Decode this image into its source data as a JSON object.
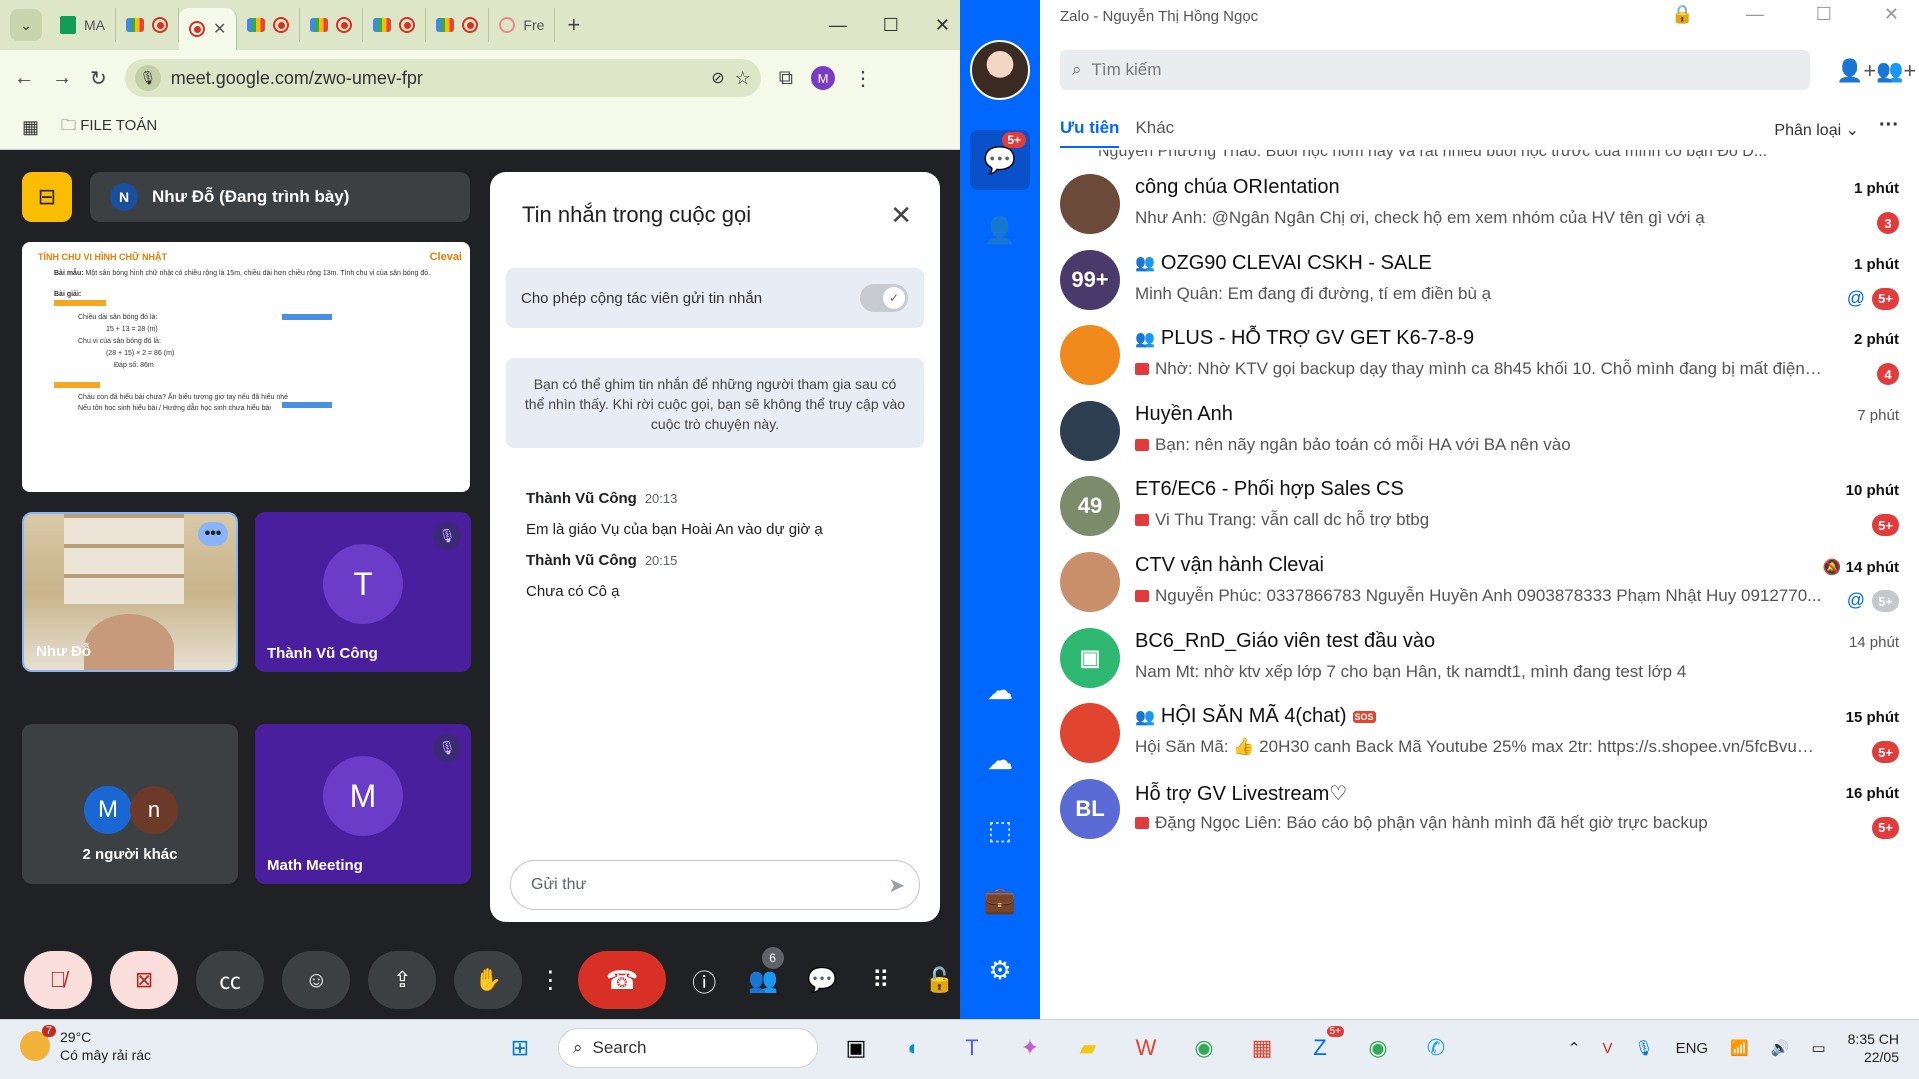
{
  "browser": {
    "tabs": [
      {
        "label": "MA",
        "icon": "sheets-icon"
      },
      {
        "label": "",
        "icon": "meet-icon"
      },
      {
        "label": "",
        "icon": "meet-icon"
      },
      {
        "label": "",
        "icon": "meet-icon"
      },
      {
        "label": "",
        "icon": "meet-icon"
      },
      {
        "label": "",
        "icon": "meet-icon"
      },
      {
        "label": "",
        "icon": "meet-icon"
      },
      {
        "label": "Fre",
        "icon": "page-icon"
      }
    ],
    "url": "meet.google.com/zwo-umev-fpr",
    "profile_initial": "M",
    "bookmark_folder": "FILE TOÁN"
  },
  "meet": {
    "presenter_initial": "N",
    "presenter_label": "Như Đỗ (Đang trình bày)",
    "slide": {
      "title": "TÍNH CHU VI HÌNH CHỮ NHẬT",
      "brand": "Clevai",
      "problem_label": "Bài mẫu:",
      "problem_text": "Một sân bóng hình chữ nhật có chiều rộng là 15m, chiều dài hơn chiều rộng 13m. Tính chu vi của sân bóng đó.",
      "solution_label": "Bài giải:",
      "line1": "Chiều dài sân bóng đó là:",
      "line2": "15 + 13 = 28 (m)",
      "line3": "Chu vi của sân bóng đó là:",
      "line4": "(28 + 15) × 2 = 86 (m)",
      "line5": "Đáp số: 86m",
      "hint1": "Cháu con đã hiểu bài chưa? Ấn biểu tượng giơ tay nếu đã hiểu nhé",
      "hint2": "Nếu tôn hoc sinh hiểu bài / Hướng dẫn học sinh chưa hiểu bài"
    },
    "tiles": {
      "self_name": "Như Đỗ",
      "t1_initial": "T",
      "t1_name": "Thành Vũ Công",
      "others_a": "M",
      "others_b": "n",
      "others_label": "2 người khác",
      "t2_initial": "M",
      "t2_name": "Math Meeting"
    },
    "chat": {
      "title": "Tin nhắn trong cuộc gọi",
      "allow_label": "Cho phép cộng tác viên gửi tin nhắn",
      "pin_note": "Bạn có thể ghim tin nhắn để những người tham gia sau có thể nhìn thấy. Khi rời cuộc gọi, bạn sẽ không thể truy cập vào cuộc trò chuyện này.",
      "messages": [
        {
          "sender": "Thành Vũ Công",
          "time": "20:13",
          "text": "Em là giáo Vụ của bạn Hoài An vào dự giờ ạ"
        },
        {
          "sender": "Thành Vũ Công",
          "time": "20:15",
          "text": "Chưa có Cô ạ"
        }
      ],
      "input_placeholder": "Gửi thư"
    },
    "participants_count": "6"
  },
  "zalo": {
    "window_title": "Zalo - Nguyễn Thị Hồng Ngọc",
    "search_placeholder": "Tìm kiếm",
    "tab_priority": "Ưu tiên",
    "tab_other": "Khác",
    "filter_label": "Phân loại",
    "messages_badge": "5+",
    "cut_preview": "Nguyễn Phương Thảo: Buổi học hôm nay và rất nhiều buổi học trước của mình có bạn Đỗ D...",
    "conversations": [
      {
        "name": "công chúa ORIentation",
        "preview": "Như Anh: @Ngân Ngân Chị ơi, check hộ em xem nhóm của HV tên gì với ạ",
        "time": "1 phút",
        "count": "3",
        "group": false,
        "flag": false,
        "av_bg": "#6b4a3a",
        "av_text": ""
      },
      {
        "name": "OZG90 CLEVAI CSKH - SALE",
        "preview": "Minh Quân: Em đang đi đường, tí em điền bù ạ",
        "time": "1 phút",
        "count": "5+",
        "group": true,
        "flag": false,
        "at": true,
        "av_bg": "#4a3a6b",
        "av_text": "99+"
      },
      {
        "name": "PLUS - HỖ TRỢ GV GET K6-7-8-9",
        "preview": "Nhờ: Nhờ KTV gọi backup dạy thay mình ca 8h45 khối 10. Chỗ mình đang bị mất điện ạ. ...",
        "time": "2 phút",
        "count": "4",
        "group": true,
        "flag": true,
        "av_bg": "#f08a1c",
        "av_text": ""
      },
      {
        "name": "Huyền Anh",
        "preview": "Bạn: nên nãy ngân bảo toán có mỗi HA với BA nên vào",
        "time": "7 phút",
        "count": "",
        "group": false,
        "flag": true,
        "av_bg": "#2c3e50",
        "av_text": ""
      },
      {
        "name": "ET6/EC6 - Phối hợp Sales  CS",
        "preview": "Vi Thu Trang: vẫn call dc hỗ trợ btbg",
        "time": "10 phút",
        "count": "5+",
        "group": false,
        "flag": true,
        "av_bg": "#7a8c6a",
        "av_text": "49"
      },
      {
        "name": "CTV vận hành Clevai",
        "preview": "Nguyễn Phúc: 0337866783 Nguyễn Huyền Anh 0903878333 Phạm Nhật Huy 0912770...",
        "time": "14 phút",
        "count": "5+",
        "count_grey": true,
        "group": false,
        "flag": true,
        "at": true,
        "muted": true,
        "av_bg": "#c98f6a",
        "av_text": ""
      },
      {
        "name": "BC6_RnD_Giáo viên test đầu vào",
        "preview": "Nam Mt: nhờ ktv xếp lớp 7 cho bạn Hân, tk namdt1, mình đang test lớp 4",
        "time": "14 phút",
        "count": "",
        "group": false,
        "flag": false,
        "av_bg": "#2eb872",
        "av_text": "▣"
      },
      {
        "name": "HỘI SĂN MÃ 4(chat)",
        "preview": "Hội Săn Mã: 👍 20H30 canh Back Mã Youtube 25% max 2tr: https://s.shopee.vn/5fcBvuE90j ...",
        "time": "15 phút",
        "count": "5+",
        "group": true,
        "flag": false,
        "sos": "SOS",
        "av_bg": "#e2452f",
        "av_text": ""
      },
      {
        "name": "Hỗ trợ GV Livestream♡",
        "preview": "Đặng Ngọc Liên: Báo cáo bộ phận vận hành mình đã hết giờ trực backup",
        "time": "16 phút",
        "count": "5+",
        "group": false,
        "flag": true,
        "av_bg": "#5b6bd6",
        "av_text": "BL"
      }
    ]
  },
  "taskbar": {
    "weather_temp": "29°C",
    "weather_desc": "Có mây rải rác",
    "weather_badge": "7",
    "search_label": "Search",
    "zalo_badge": "5+",
    "lang": "ENG",
    "time": "8:35 CH",
    "date": "22/05"
  }
}
